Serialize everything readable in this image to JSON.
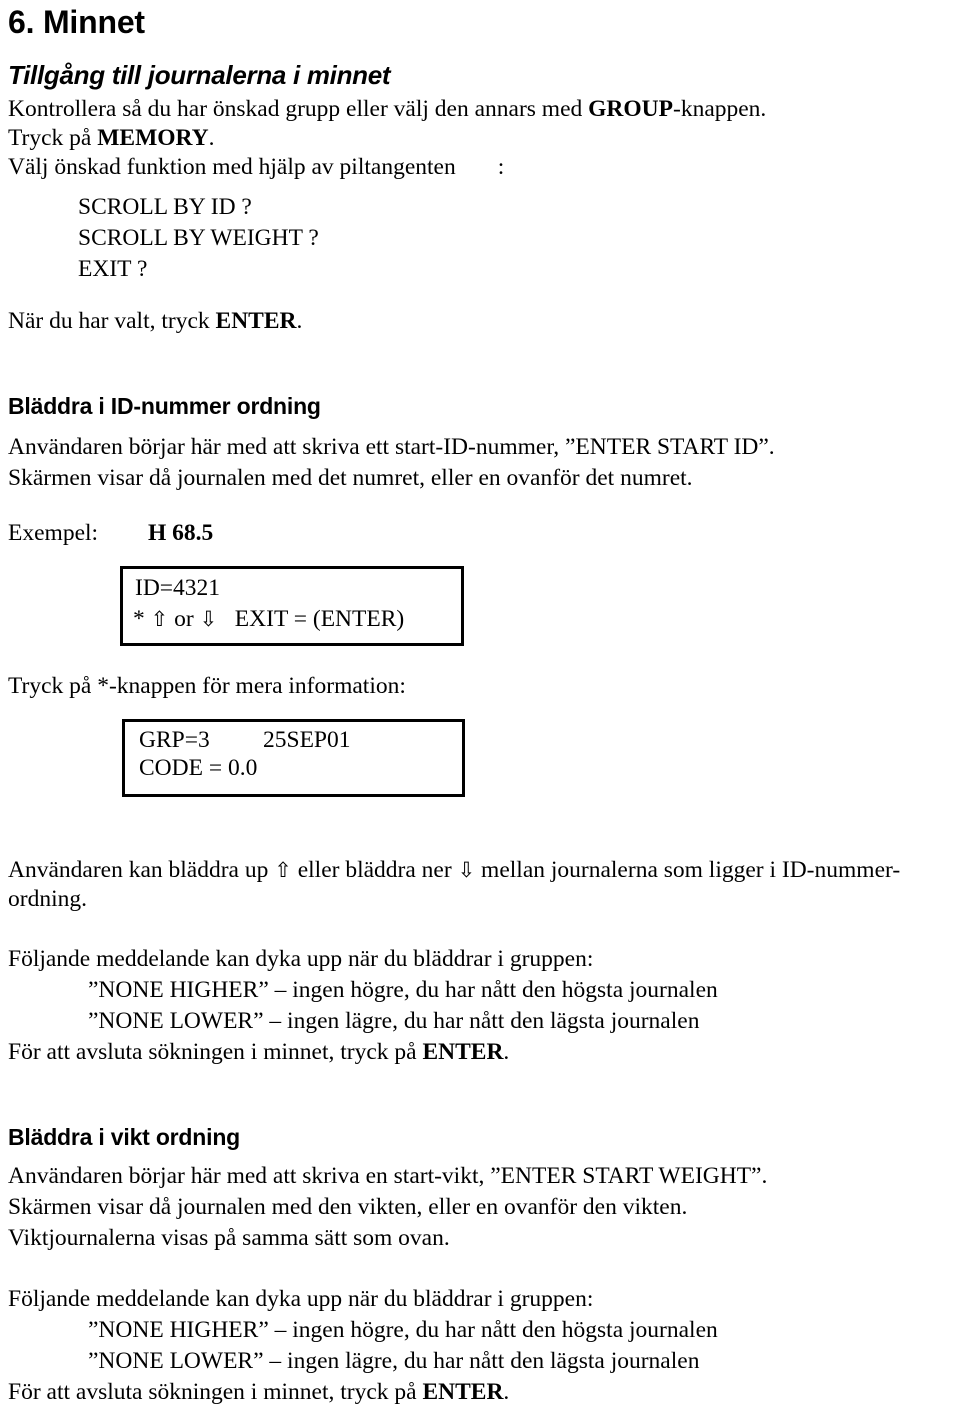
{
  "document": {
    "chapter_heading": "6. Minnet",
    "section_heading": "Tillgång till journalerna i minnet",
    "intro": {
      "line1_pre": "Kontrollera så du har önskad grupp eller välj den annars med ",
      "line1_bold": "GROUP",
      "line1_post": "-knappen.",
      "line2_pre": "Tryck på ",
      "line2_bold": "MEMORY",
      "line2_post": ".",
      "line3": "Välj önskad funktion med hjälp av piltangenten",
      "line3_colon": ":",
      "options": [
        "SCROLL BY ID ?",
        "SCROLL BY WEIGHT ?",
        "EXIT ?"
      ],
      "line4_pre": "När du har valt, tryck ",
      "line4_bold": "ENTER",
      "line4_post": "."
    },
    "section_id": {
      "heading": "Bläddra i ID-nummer ordning",
      "line1": "Användaren börjar här med att skriva ett start-ID-nummer, ”ENTER START ID”.",
      "line2": "Skärmen visar då journalen med det numret, eller en ovanför det numret.",
      "example_label": "Exempel:",
      "example_value": "H 68.5",
      "lcd1": {
        "row1": "ID=4321",
        "row2_prefix": "* ",
        "row2_arrow_up": "⇧",
        "row2_mid": " or ",
        "row2_arrow_down": "⇩",
        "row2_suffix": "   EXIT = (ENTER)"
      },
      "press_star": "Tryck på *-knappen för mera information:",
      "lcd2": {
        "row1_left": "GRP=3",
        "row1_right": "25SEP01",
        "row2": "CODE = 0.0"
      },
      "scroll_note_pre": "Användaren kan bläddra up ",
      "scroll_note_arrow_up": "⇧",
      "scroll_note_mid": " eller bläddra ner ",
      "scroll_note_arrow_down": "⇩",
      "scroll_note_post": " mellan journalerna som ligger i ID-nummer-",
      "scroll_note_wrap": "ordning."
    },
    "messages_block_1": {
      "intro": "Följande meddelande kan dyka upp när du bläddrar i gruppen:",
      "msg_higher": "”NONE HIGHER” – ingen högre, du har nått den högsta journalen",
      "msg_lower": "”NONE LOWER” – ingen lägre, du har nått den lägsta journalen",
      "exit_pre": "För att avsluta sökningen i minnet, tryck på ",
      "exit_bold": "ENTER",
      "exit_post": "."
    },
    "section_weight": {
      "heading": "Bläddra i vikt ordning",
      "line1": "Användaren börjar här med att skriva en start-vikt, ”ENTER START WEIGHT”.",
      "line2": "Skärmen visar då journalen med den vikten, eller en ovanför den vikten.",
      "line3": "Viktjournalerna visas på samma sätt som ovan."
    },
    "messages_block_2": {
      "intro": "Följande meddelande kan dyka upp när du bläddrar i gruppen:",
      "msg_higher": "”NONE HIGHER” – ingen högre, du har nått den högsta journalen",
      "msg_lower": "”NONE LOWER” – ingen lägre, du har nått den lägsta journalen",
      "exit_pre": "För att avsluta sökningen i minnet, tryck på ",
      "exit_bold": "ENTER",
      "exit_post": "."
    }
  }
}
